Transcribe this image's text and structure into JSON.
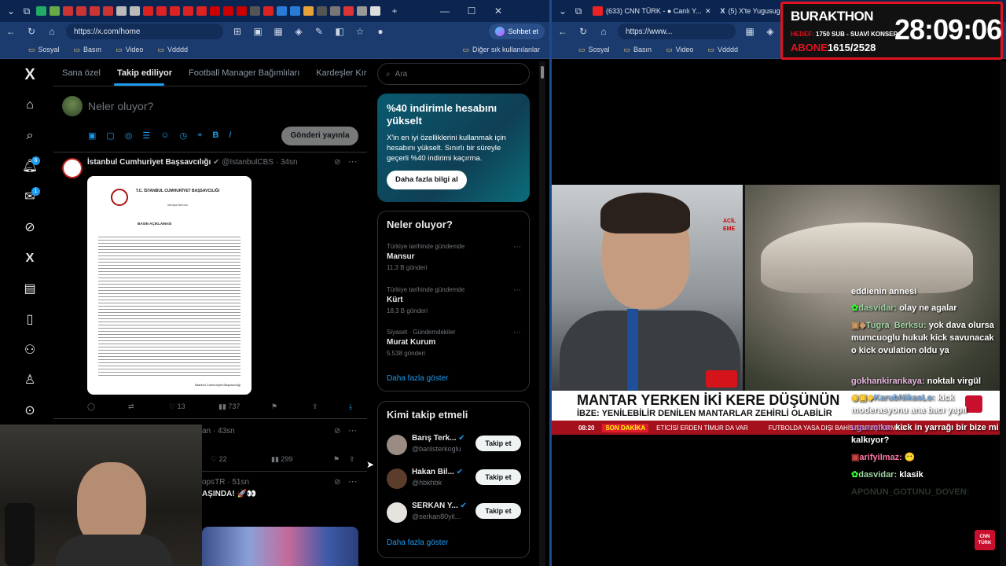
{
  "left_browser": {
    "tab_count_label": "TS T8 TS T8",
    "new_tab": "+",
    "url": "https://x.com/home",
    "chat_button": "Sohbet et",
    "bookmarks": [
      "Sosyal",
      "Basın",
      "Video",
      "Vdddd"
    ],
    "other_bookmarks": "Diğer sık kullanılanlar"
  },
  "x_app": {
    "logo": "X",
    "nav": [
      {
        "icon": "home-icon",
        "glyph": "⌂"
      },
      {
        "icon": "search-icon",
        "glyph": "⌕"
      },
      {
        "icon": "bell-icon",
        "glyph": "♫",
        "badge": "6"
      },
      {
        "icon": "mail-icon",
        "glyph": "✉",
        "badge": "1"
      },
      {
        "icon": "grok-icon",
        "glyph": "◎"
      },
      {
        "icon": "x-premium-icon",
        "glyph": "✕"
      },
      {
        "icon": "lists-icon",
        "glyph": "▤"
      },
      {
        "icon": "bookmark-icon",
        "glyph": "⚑"
      },
      {
        "icon": "communities-icon",
        "glyph": "⚇"
      },
      {
        "icon": "profile-icon",
        "glyph": "⚲"
      },
      {
        "icon": "more-icon",
        "glyph": "⋯"
      }
    ],
    "tabs": [
      "Sana özel",
      "Takip ediliyor",
      "Football Manager Bağımlıları",
      "Kardeşler Kıraath"
    ],
    "compose_placeholder": "Neler oluyor?",
    "post_button": "Gönderi yayınla",
    "post1": {
      "author": "İstanbul Cumhuriyet Başsavcılığı",
      "handle": "@IstanbulCBS",
      "time": "34sn",
      "doc_header": "T.C. İSTANBUL CUMHURİYET BAŞSAVCILIĞI",
      "doc_sub": "Medya Bürosu",
      "doc_title": "BASIN AÇIKLAMASI",
      "doc_footer": "İstanbul Cumhuriyet Başsavcılığı",
      "likes": "13",
      "views": "737"
    },
    "post2": {
      "handle_tail": "an · 43sn",
      "likes": "22",
      "views": "299"
    },
    "post3": {
      "handle_tail": "opsTR · 51sn",
      "text": "AŞINDA! 🚀👀"
    },
    "search_placeholder": "Ara",
    "premium": {
      "title": "%40 indirimle hesabını yükselt",
      "body": "X'in en iyi özelliklerini kullanmak için hesabını yükselt. Sınırlı bir süreyle geçerli %40 indirimi kaçırma.",
      "cta": "Daha fazla bilgi al"
    },
    "trends": {
      "title": "Neler oluyor?",
      "items": [
        {
          "context": "Türkiye tarihinde gündemde",
          "name": "Mansur",
          "count": "11,3 B gönderi"
        },
        {
          "context": "Türkiye tarihinde gündemde",
          "name": "Kürt",
          "count": "18,3 B gönderi"
        },
        {
          "context": "Siyaset · Gündemdekiler",
          "name": "Murat Kurum",
          "count": "5.538 gönderi"
        }
      ],
      "more": "Daha fazla göster"
    },
    "who_to_follow": {
      "title": "Kimi takip etmeli",
      "users": [
        {
          "name": "Barış Terk...",
          "handle": "@bariisterkoglu",
          "button": "Takip et"
        },
        {
          "name": "Hakan Bil...",
          "handle": "@hbkhbk",
          "button": "Takip et"
        },
        {
          "name": "SERKAN Y...",
          "handle": "@serkan80yil...",
          "button": "Takip et"
        }
      ],
      "more": "Daha fazla göster"
    }
  },
  "right_browser": {
    "tab1": "(633) CNN TÜRK - ● Canlı Y...",
    "tab2": "(5) X'te Yugusugu ...",
    "url": "https://www...",
    "bookmarks": [
      "Sosyal",
      "Basın",
      "Video",
      "Vdddd"
    ]
  },
  "overlay": {
    "name": "BURAKTHON",
    "goal_label": "HEDEF:",
    "goal": "1750 SUB - SUAVİ KONSER",
    "subs_label": "ABONE",
    "subs": "1615/2528",
    "timer": "28:09:06"
  },
  "tv": {
    "headline": "MANTAR YERKEN İKİ KERE DÜŞÜNÜN",
    "subline": "İBZE: YENİLEBİLİR DENİLEN MANTARLAR ZEHİRLİ OLABİLİR",
    "time": "08:20",
    "breaking": "SON DAKİKA",
    "ticker1": "ETİCİSİ ERDEN TİMUR DA VAR",
    "ticker2": "FUTBOLDA YASA DIŞI BAHİS SORUŞTURMASI",
    "logo": "CNN TÜRK",
    "hospital_sign": "ACİL EME"
  },
  "chat": [
    {
      "user": "",
      "text": "eddienin annesi"
    },
    {
      "user": "dasvidar:",
      "text": "olay ne agalar"
    },
    {
      "user": "Tugra_Berksu:",
      "text": "yok dava olursa mumcuoglu hukuk kick savunacak o kick ovulation oldu ya"
    },
    {
      "user": "gokhankirankaya:",
      "text": "noktalı virgül"
    },
    {
      "user": "KarubNikasLo:",
      "text": "kick moderasyonu ana bacı yapıl"
    },
    {
      "user": "ugurmika:",
      "text": "kick in yarrağı bir bize mi kalkıyor?"
    },
    {
      "user": "arifyilmaz:",
      "text": "😶"
    },
    {
      "user": "dasvidar:",
      "text": "klasik"
    },
    {
      "user": "APONUN_GOTUNU_DOVEN:",
      "text": ""
    }
  ],
  "colors": {
    "accent": "#1d9bf0",
    "overlay_red": "#e0141f",
    "cnn_red": "#c8102e"
  }
}
